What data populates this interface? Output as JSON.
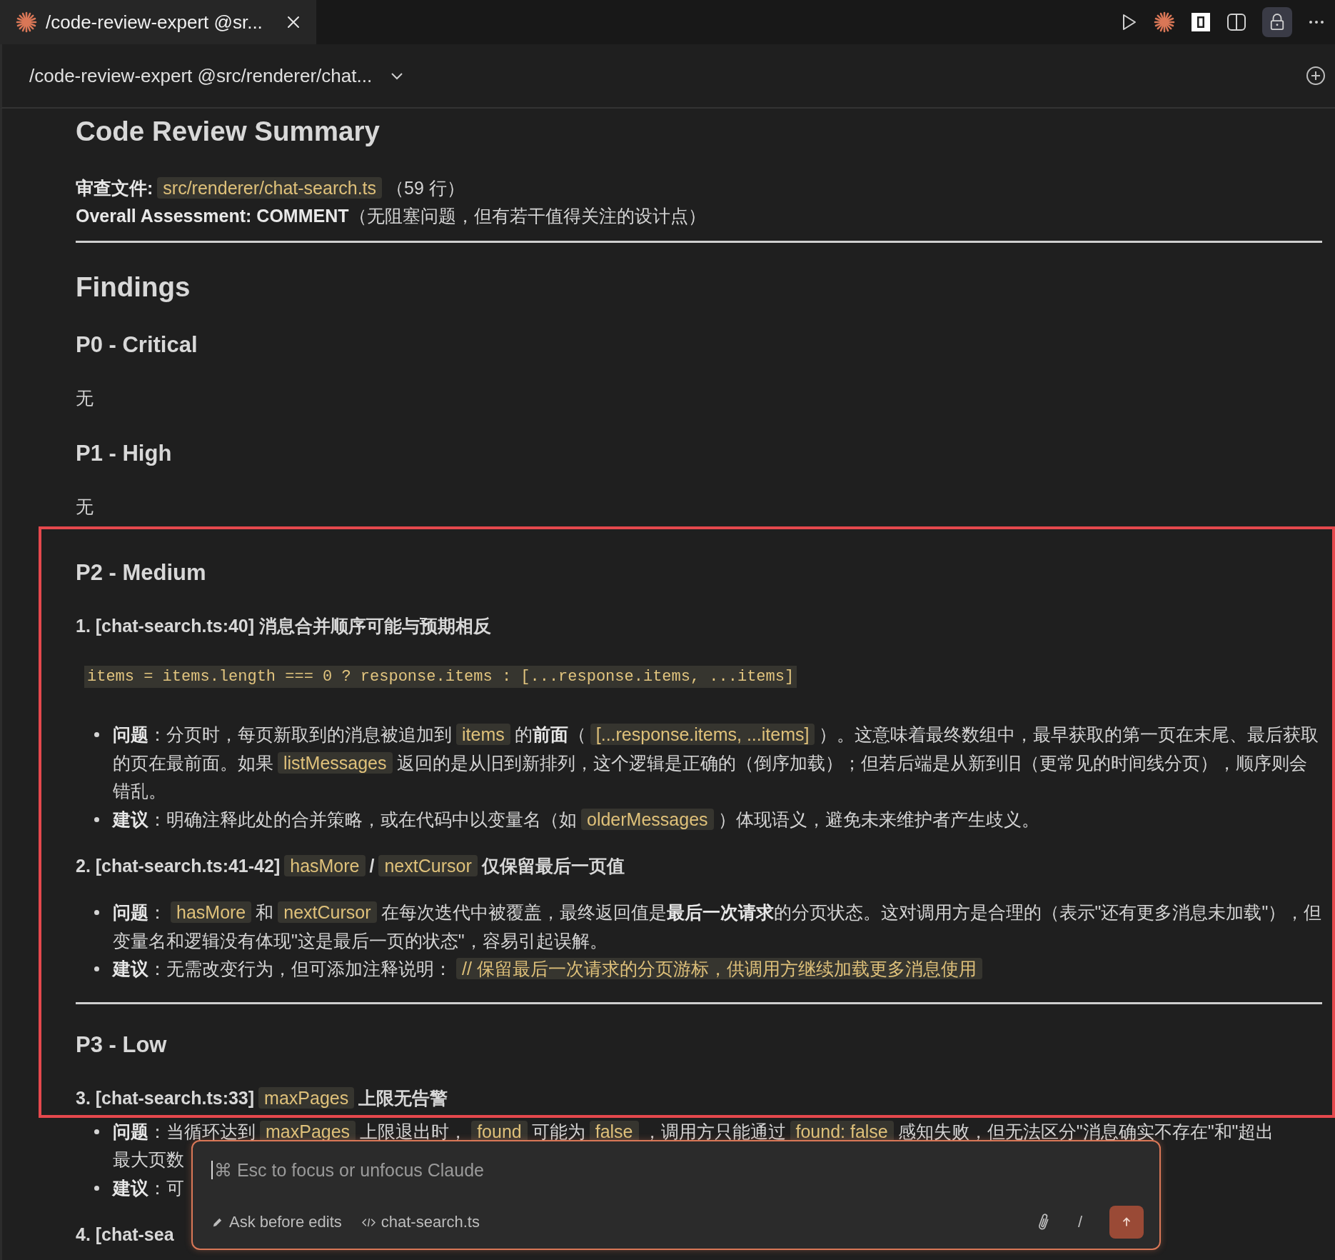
{
  "tab": {
    "title": "/code-review-expert @sr..."
  },
  "session": {
    "title": "/code-review-expert @src/renderer/chat..."
  },
  "sections": [
    {
      "framed": false,
      "blocks": [
        {
          "kind": "h1",
          "text": "Code Review Summary"
        },
        {
          "kind": "p",
          "segments": [
            {
              "kind": "bold",
              "text": "审查文件:"
            },
            {
              "kind": "code",
              "text": "src/renderer/chat-search.ts"
            },
            {
              "kind": "text",
              "text": "（59 行）"
            },
            {
              "kind": "break"
            },
            {
              "kind": "bold",
              "text": "Overall Assessment: COMMENT"
            },
            {
              "kind": "text",
              "text": "（无阻塞问题，但有若干值得关注的设计点）"
            }
          ]
        },
        {
          "kind": "hr"
        },
        {
          "kind": "h2",
          "text": "Findings"
        },
        {
          "kind": "h3",
          "text": "P0 - Critical"
        },
        {
          "kind": "p",
          "segments": [
            {
              "kind": "text",
              "text": "无"
            }
          ]
        },
        {
          "kind": "h3",
          "text": "P1 - High"
        },
        {
          "kind": "p",
          "segments": [
            {
              "kind": "text",
              "text": "无"
            }
          ]
        }
      ]
    },
    {
      "framed": true,
      "blocks": [
        {
          "kind": "h3",
          "text": "P2 - Medium"
        },
        {
          "kind": "h4",
          "segments": [
            {
              "kind": "text",
              "text": "1. [chat-search.ts:40] 消息合并顺序可能与预期相反"
            }
          ]
        },
        {
          "kind": "code",
          "text": "items = items.length === 0 ? response.items : [...response.items, ...items]"
        },
        {
          "kind": "list",
          "items": [
            {
              "segments": [
                {
                  "kind": "bold",
                  "text": "问题"
                },
                {
                  "kind": "text",
                  "text": "：分页时，每页新取到的消息被追加到"
                },
                {
                  "kind": "code",
                  "text": "items"
                },
                {
                  "kind": "text",
                  "text": "的"
                },
                {
                  "kind": "bold",
                  "text": "前面"
                },
                {
                  "kind": "text",
                  "text": "（"
                },
                {
                  "kind": "code",
                  "text": "[...response.items, ...items]"
                },
                {
                  "kind": "text",
                  "text": "）。这意味着最终数组中，最早获取的第一页在末尾、最后获取的页在最前面。如果"
                },
                {
                  "kind": "code",
                  "text": "listMessages"
                },
                {
                  "kind": "text",
                  "text": "返回的是从旧到新排列，这个逻辑是正确的（倒序加载）；但若后端是从新到旧（更常见的时间线分页），顺序则会错乱。"
                }
              ]
            },
            {
              "segments": [
                {
                  "kind": "bold",
                  "text": "建议"
                },
                {
                  "kind": "text",
                  "text": "：明确注释此处的合并策略，或在代码中以变量名（如"
                },
                {
                  "kind": "code",
                  "text": "olderMessages"
                },
                {
                  "kind": "text",
                  "text": "）体现语义，避免未来维护者产生歧义。"
                }
              ]
            }
          ]
        },
        {
          "kind": "h4",
          "segments": [
            {
              "kind": "text",
              "text": "2. [chat-search.ts:41-42]"
            },
            {
              "kind": "code",
              "text": "hasMore"
            },
            {
              "kind": "text",
              "text": "/"
            },
            {
              "kind": "code",
              "text": "nextCursor"
            },
            {
              "kind": "text",
              "text": "仅保留最后一页值"
            }
          ]
        },
        {
          "kind": "list",
          "items": [
            {
              "segments": [
                {
                  "kind": "bold",
                  "text": "问题"
                },
                {
                  "kind": "text",
                  "text": "："
                },
                {
                  "kind": "code",
                  "text": "hasMore"
                },
                {
                  "kind": "text",
                  "text": "和"
                },
                {
                  "kind": "code",
                  "text": "nextCursor"
                },
                {
                  "kind": "text",
                  "text": "在每次迭代中被覆盖，最终返回值是"
                },
                {
                  "kind": "bold",
                  "text": "最后一次请求"
                },
                {
                  "kind": "text",
                  "text": "的分页状态。这对调用方是合理的（表示\"还有更多消息未加载\"），但变量名和逻辑没有体现\"这是最后一页的状态\"，容易引起误解。"
                }
              ]
            },
            {
              "segments": [
                {
                  "kind": "bold",
                  "text": "建议"
                },
                {
                  "kind": "text",
                  "text": "：无需改变行为，但可添加注释说明："
                },
                {
                  "kind": "code",
                  "text": "// 保留最后一次请求的分页游标，供调用方继续加载更多消息使用"
                }
              ]
            }
          ]
        },
        {
          "kind": "hr"
        },
        {
          "kind": "h3",
          "text": "P3 - Low"
        },
        {
          "kind": "h4",
          "segments": [
            {
              "kind": "text",
              "text": "3. [chat-search.ts:33]"
            },
            {
              "kind": "code",
              "text": "maxPages"
            },
            {
              "kind": "text",
              "text": "上限无告警"
            }
          ]
        }
      ]
    },
    {
      "framed": false,
      "blocks": [
        {
          "kind": "list",
          "items": [
            {
              "segments": [
                {
                  "kind": "bold",
                  "text": "问题"
                },
                {
                  "kind": "text",
                  "text": "：当循环达到"
                },
                {
                  "kind": "code",
                  "text": "maxPages"
                },
                {
                  "kind": "text",
                  "text": "上限退出时，"
                },
                {
                  "kind": "code",
                  "text": "found"
                },
                {
                  "kind": "text",
                  "text": "可能为"
                },
                {
                  "kind": "code",
                  "text": "false"
                },
                {
                  "kind": "text",
                  "text": "，调用方只能通过"
                },
                {
                  "kind": "code",
                  "text": "found: false"
                },
                {
                  "kind": "text",
                  "text": "感知失败，但无法区分\"消息确实不存在\"和\"超出"
                },
                {
                  "kind": "break"
                },
                {
                  "kind": "text",
                  "text": "最大页数"
                }
              ]
            },
            {
              "segments": [
                {
                  "kind": "bold",
                  "text": "建议"
                },
                {
                  "kind": "text",
                  "text": "：可"
                }
              ]
            }
          ]
        },
        {
          "kind": "h4",
          "segments": [
            {
              "kind": "text",
              "text": "4. [chat-sea"
            }
          ]
        }
      ]
    }
  ],
  "composer": {
    "placeholder": "⌘ Esc to focus or unfocus Claude",
    "mode": "Ask before edits",
    "file": "chat-search.ts",
    "slash": "/"
  }
}
